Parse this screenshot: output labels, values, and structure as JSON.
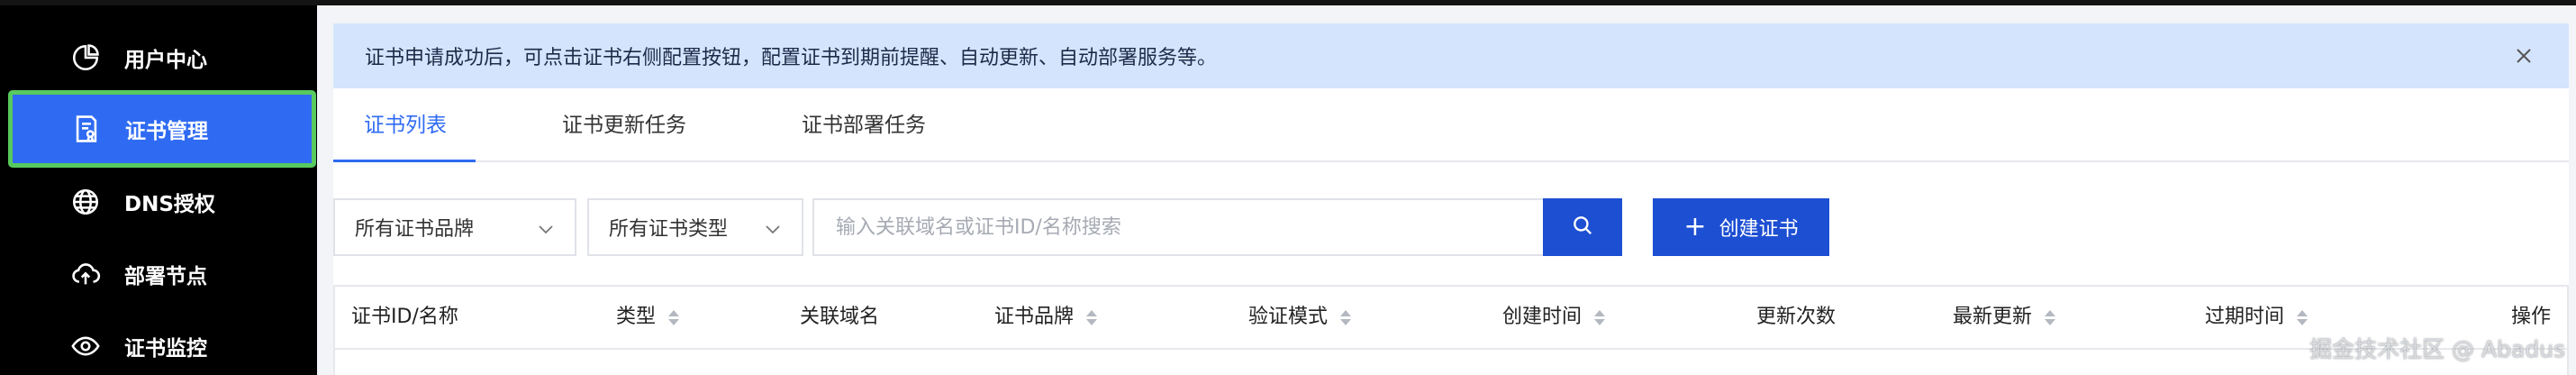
{
  "sidebar": {
    "items": [
      {
        "label": "用户中心",
        "icon": "pie-chart-icon",
        "active": false
      },
      {
        "label": "证书管理",
        "icon": "certificate-icon",
        "active": true
      },
      {
        "label": "DNS授权",
        "icon": "globe-icon",
        "active": false
      },
      {
        "label": "部署节点",
        "icon": "cloud-upload-icon",
        "active": false
      },
      {
        "label": "证书监控",
        "icon": "eye-icon",
        "active": false
      }
    ]
  },
  "alert": {
    "text": "证书申请成功后，可点击证书右侧配置按钮，配置证书到期前提醒、自动更新、自动部署服务等。"
  },
  "tabs": [
    {
      "label": "证书列表",
      "active": true
    },
    {
      "label": "证书更新任务",
      "active": false
    },
    {
      "label": "证书部署任务",
      "active": false
    }
  ],
  "filters": {
    "brand": "所有证书品牌",
    "type": "所有证书类型"
  },
  "search": {
    "placeholder": "输入关联域名或证书ID/名称搜索",
    "value": ""
  },
  "actions": {
    "create_label": "创建证书"
  },
  "table": {
    "columns": [
      {
        "label": "证书ID/名称",
        "sortable": false
      },
      {
        "label": "类型",
        "sortable": true
      },
      {
        "label": "关联域名",
        "sortable": false
      },
      {
        "label": "证书品牌",
        "sortable": true
      },
      {
        "label": "验证模式",
        "sortable": true
      },
      {
        "label": "创建时间",
        "sortable": true
      },
      {
        "label": "更新次数",
        "sortable": false
      },
      {
        "label": "最新更新",
        "sortable": true
      },
      {
        "label": "过期时间",
        "sortable": true
      },
      {
        "label": "操作",
        "sortable": false
      }
    ]
  },
  "watermark": "掘金技术社区 @ Abadus",
  "colors": {
    "accent": "#2f6bf2",
    "primary_button": "#1d4fd3",
    "alert_bg": "#d5e4fd",
    "sidebar_bg": "#000000",
    "active_outline": "#57c95e"
  }
}
